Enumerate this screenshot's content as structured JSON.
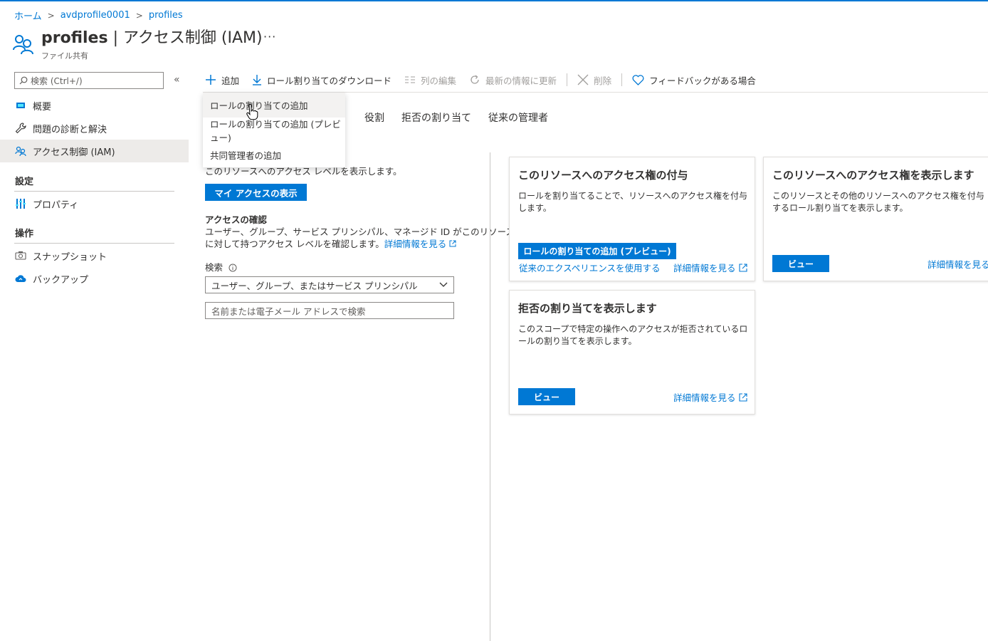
{
  "breadcrumb": {
    "home": "ホーム",
    "storage": "avdprofile0001",
    "current": "profiles"
  },
  "header": {
    "title_bold": "profiles",
    "title_rest": " | アクセス制御 (IAM)",
    "subtitle": "ファイル共有",
    "more": "···"
  },
  "sidebar": {
    "search_placeholder": "検索 (Ctrl+/)",
    "collapse": "«",
    "items": [
      {
        "label": "概要",
        "icon": "overview-icon"
      },
      {
        "label": "問題の診断と解決",
        "icon": "wrench-icon"
      },
      {
        "label": "アクセス制御 (IAM)",
        "icon": "people-icon",
        "selected": true
      }
    ],
    "settings_header": "設定",
    "settings_items": [
      {
        "label": "プロパティ",
        "icon": "properties-icon"
      }
    ],
    "operations_header": "操作",
    "operations_items": [
      {
        "label": "スナップショット",
        "icon": "snapshot-icon"
      },
      {
        "label": "バックアップ",
        "icon": "backup-icon"
      }
    ]
  },
  "toolbar": {
    "add": "追加",
    "download": "ロール割り当てのダウンロード",
    "edit_columns": "列の編集",
    "refresh": "最新の情報に更新",
    "delete": "削除",
    "feedback": "フィードバックがある場合"
  },
  "add_menu": {
    "items": [
      "ロールの割り当ての追加",
      "ロールの割り当ての追加 (プレビュー)",
      "共同管理者の追加"
    ]
  },
  "tabs": [
    "役割",
    "拒否の割り当て",
    "従来の管理者"
  ],
  "my_access": {
    "description": "このリソースへのアクセス レベルを表示します。",
    "button": "マイ アクセスの表示"
  },
  "check_access": {
    "title": "アクセスの確認",
    "description_line1": "ユーザー、グループ、サービス プリンシパル、マネージド ID がこのリソース",
    "description_line2": "に対して持つアクセス レベルを確認します。",
    "learn_more": "詳細情報を見る",
    "search_label": "検索",
    "select_value": "ユーザー、グループ、またはサービス プリンシパル",
    "input_placeholder": "名前または電子メール アドレスで検索"
  },
  "cards": {
    "grant": {
      "title": "このリソースへのアクセス権の付与",
      "description": "ロールを割り当てることで、リソースへのアクセス権を付与します。",
      "button": "ロールの割り当ての追加 (プレビュー)",
      "classic_link": "従来のエクスペリエンスを使用する",
      "learn_more": "詳細情報を見る"
    },
    "view": {
      "title": "このリソースへのアクセス権を表示します",
      "description": "このリソースとその他のリソースへのアクセス権を付与するロール割り当てを表示します。",
      "button": "ビュー",
      "learn_more": "詳細情報を見る"
    },
    "deny": {
      "title": "拒否の割り当てを表示します",
      "description": "このスコープで特定の操作へのアクセスが拒否されているロールの割り当てを表示します。",
      "button": "ビュー",
      "learn_more": "詳細情報を見る"
    }
  },
  "colors": {
    "accent": "#0078d4",
    "selected_bg": "#edebe9"
  }
}
